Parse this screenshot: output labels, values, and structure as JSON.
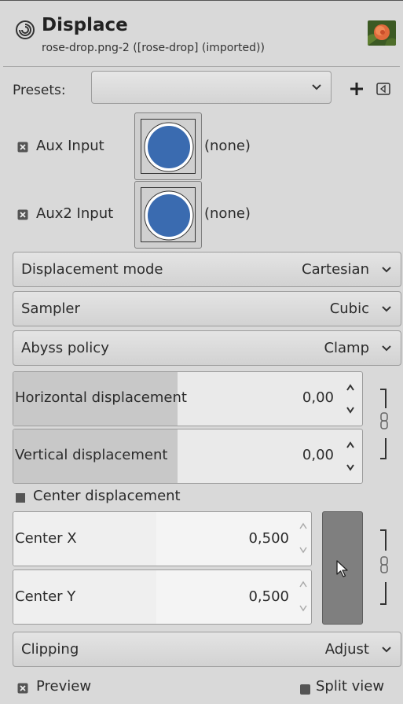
{
  "header": {
    "title": "Displace",
    "subtitle": "rose-drop.png-2 ([rose-drop] (imported))",
    "icon": "gimp-wilber-icon",
    "thumbnail": "rose-image-thumbnail"
  },
  "presets": {
    "label": "Presets:",
    "value": "",
    "add_icon": "plus-icon",
    "menu_icon": "tab-menu-icon"
  },
  "aux_inputs": [
    {
      "label": "Aux Input",
      "value": "(none)",
      "checked": true
    },
    {
      "label": "Aux2 Input",
      "value": "(none)",
      "checked": true
    }
  ],
  "combos": {
    "displacement_mode": {
      "label": "Displacement mode",
      "value": "Cartesian"
    },
    "sampler": {
      "label": "Sampler",
      "value": "Cubic"
    },
    "abyss_policy": {
      "label": "Abyss policy",
      "value": "Clamp"
    },
    "clipping": {
      "label": "Clipping",
      "value": "Adjust"
    }
  },
  "displacement": {
    "horizontal": {
      "label": "Horizontal displacement",
      "value": "0,00",
      "fill_fraction": 0.47
    },
    "vertical": {
      "label": "Vertical displacement",
      "value": "0,00",
      "fill_fraction": 0.47
    }
  },
  "center": {
    "checkbox_label": "Center displacement",
    "checked": false,
    "x": {
      "label": "Center X",
      "value": "0,500",
      "fill_fraction": 0.48
    },
    "y": {
      "label": "Center Y",
      "value": "0,500",
      "fill_fraction": 0.48
    },
    "pick_icon": "pointer-pick-icon"
  },
  "footer": {
    "preview_label": "Preview",
    "preview_checked": true,
    "split_view_label": "Split view",
    "split_view_checked": false
  },
  "colors": {
    "panel_bg": "#d9d9d9",
    "accent_blue": "#3a6bb0",
    "pick_button": "#7f7f7f"
  }
}
